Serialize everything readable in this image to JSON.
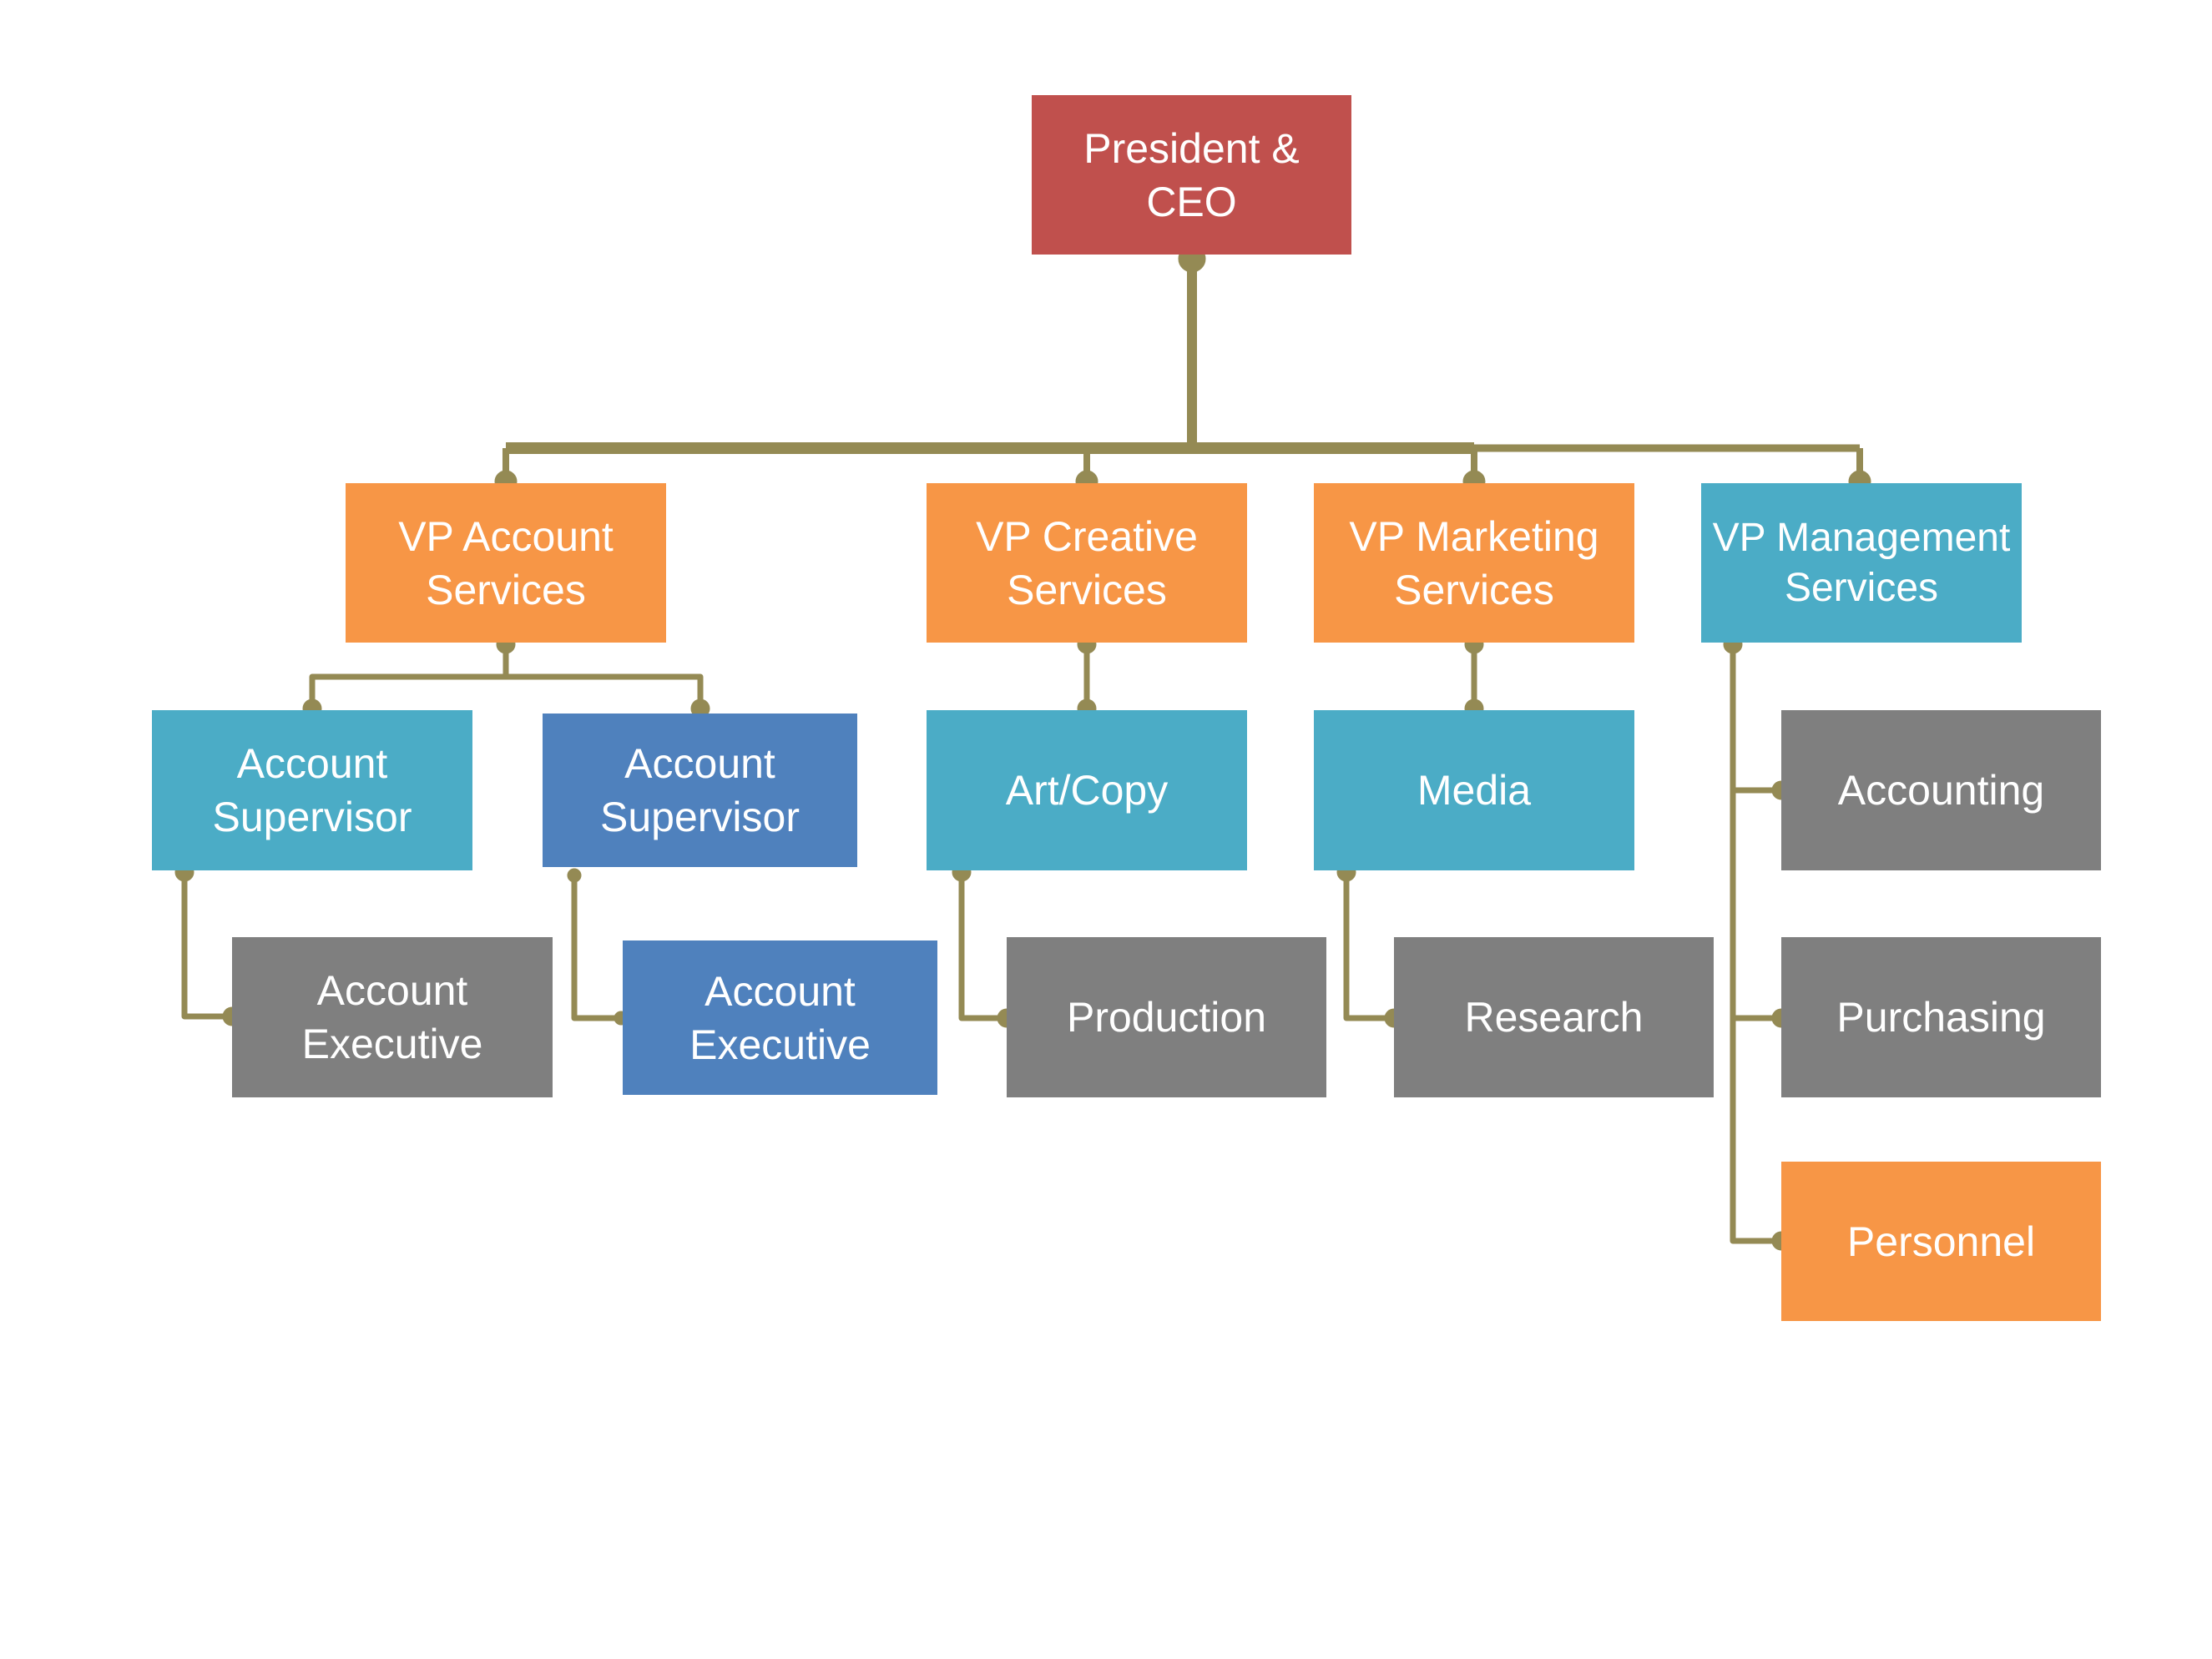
{
  "diagram": {
    "type": "org-chart",
    "colors": {
      "executive": "#C0504D",
      "orange": "#F79646",
      "teal": "#4BACC6",
      "blue": "#4F81BD",
      "grey": "#7F7F7F",
      "connector": "#948A54",
      "text": "#FFFFFF"
    },
    "nodes": [
      {
        "id": "ceo",
        "label": "President & CEO",
        "lines": [
          "President &",
          "CEO"
        ],
        "color": "executive",
        "parent": null
      },
      {
        "id": "vp-account",
        "label": "VP Account Services",
        "lines": [
          "VP Account",
          "Services"
        ],
        "color": "orange",
        "parent": "ceo"
      },
      {
        "id": "vp-creative",
        "label": "VP Creative Services",
        "lines": [
          "VP Creative",
          "Services"
        ],
        "color": "orange",
        "parent": "ceo"
      },
      {
        "id": "vp-marketing",
        "label": "VP Marketing Services",
        "lines": [
          "VP Marketing",
          "Services"
        ],
        "color": "orange",
        "parent": "ceo"
      },
      {
        "id": "vp-management",
        "label": "VP Management Services",
        "lines": [
          "VP Management",
          "Services"
        ],
        "color": "teal",
        "parent": "ceo"
      },
      {
        "id": "supervisor-1",
        "label": "Account Supervisor",
        "lines": [
          "Account",
          "Supervisor"
        ],
        "color": "teal",
        "parent": "vp-account"
      },
      {
        "id": "supervisor-2",
        "label": "Account Supervisor",
        "lines": [
          "Account",
          "Supervisor"
        ],
        "color": "blue",
        "parent": "vp-account"
      },
      {
        "id": "art-copy",
        "label": "Art/Copy",
        "lines": [
          "Art/Copy"
        ],
        "color": "teal",
        "parent": "vp-creative"
      },
      {
        "id": "media",
        "label": "Media",
        "lines": [
          "Media"
        ],
        "color": "teal",
        "parent": "vp-marketing"
      },
      {
        "id": "accounting",
        "label": "Accounting",
        "lines": [
          "Accounting"
        ],
        "color": "grey",
        "parent": "vp-management"
      },
      {
        "id": "executive-1",
        "label": "Account Executive",
        "lines": [
          "Account",
          "Executive"
        ],
        "color": "grey",
        "parent": "supervisor-1"
      },
      {
        "id": "executive-2",
        "label": "Account Executive",
        "lines": [
          "Account",
          "Executive"
        ],
        "color": "blue",
        "parent": "supervisor-2"
      },
      {
        "id": "production",
        "label": "Production",
        "lines": [
          "Production"
        ],
        "color": "grey",
        "parent": "art-copy"
      },
      {
        "id": "research",
        "label": "Research",
        "lines": [
          "Research"
        ],
        "color": "grey",
        "parent": "media"
      },
      {
        "id": "purchasing",
        "label": "Purchasing",
        "lines": [
          "Purchasing"
        ],
        "color": "grey",
        "parent": "vp-management"
      },
      {
        "id": "personnel",
        "label": "Personnel",
        "lines": [
          "Personnel"
        ],
        "color": "orange",
        "parent": "vp-management"
      }
    ]
  }
}
